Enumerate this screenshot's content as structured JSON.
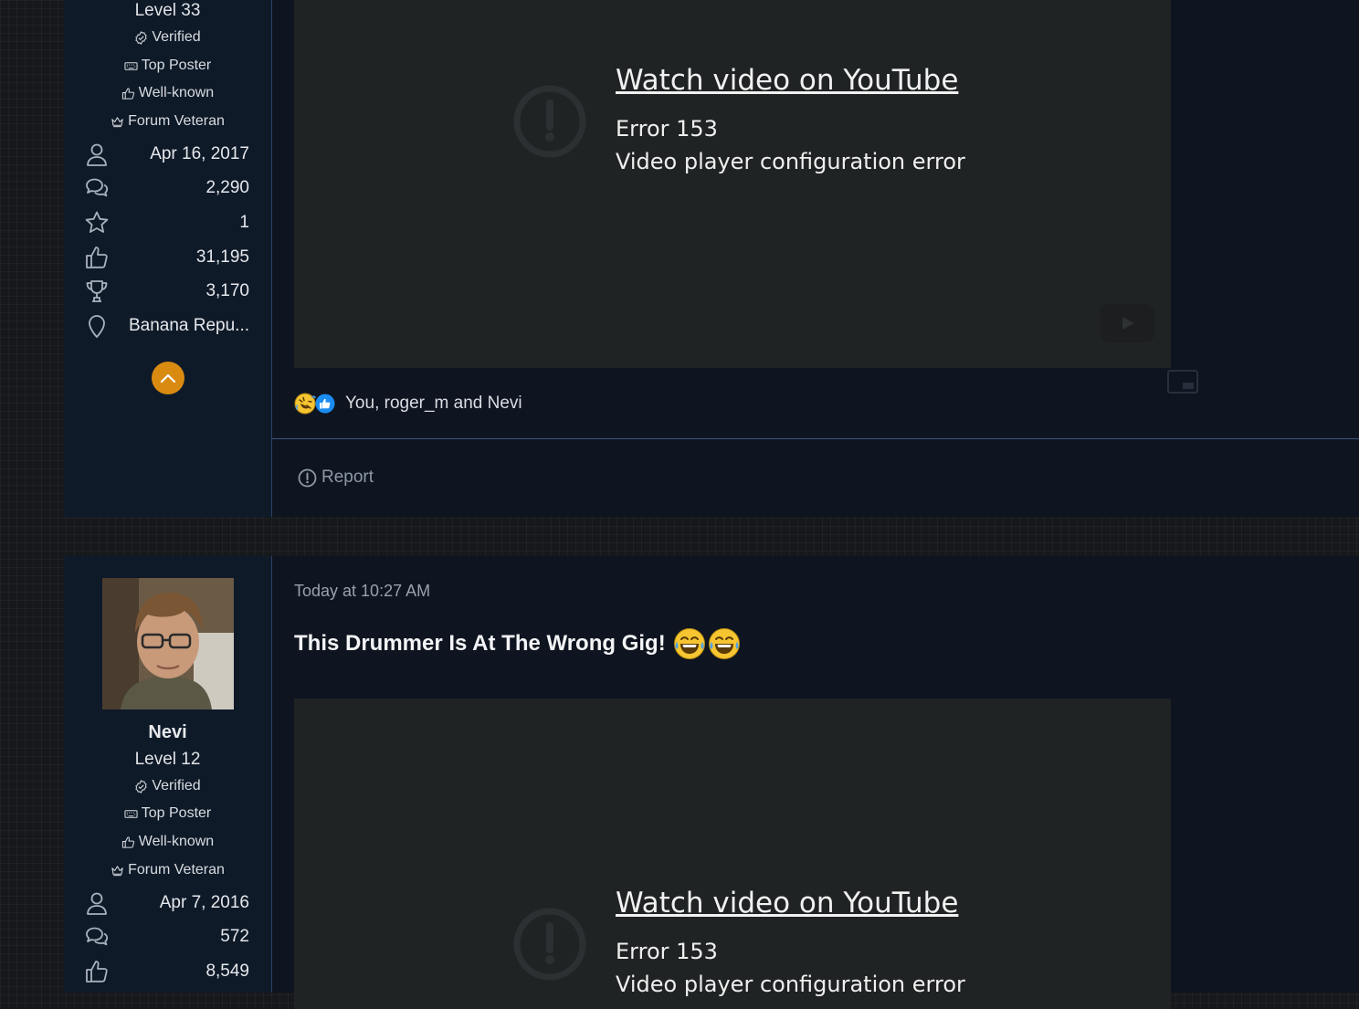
{
  "post1": {
    "user": {
      "level": "Level 33",
      "banners": [
        "Verified",
        "Top Poster",
        "Well-known",
        "Forum Veteran"
      ],
      "stats": [
        {
          "icon": "user-icon",
          "value": "Apr 16, 2017"
        },
        {
          "icon": "messages-icon",
          "value": "2,290"
        },
        {
          "icon": "star-icon",
          "value": "1"
        },
        {
          "icon": "thumbs-up-icon",
          "value": "31,195"
        },
        {
          "icon": "trophy-icon",
          "value": "3,170"
        },
        {
          "icon": "location-pin-icon",
          "value": "Banana Repu..."
        }
      ]
    },
    "video": {
      "link_text": "Watch video on YouTube",
      "error_code": "Error 153",
      "error_message": "Video player configuration error"
    },
    "reactions": {
      "icons": [
        "rofl-reaction-icon",
        "like-reaction-icon"
      ],
      "users_text": "You, roger_m and Nevi"
    },
    "report_label": "Report"
  },
  "post2": {
    "user": {
      "name": "Nevi",
      "level": "Level 12",
      "banners": [
        "Verified",
        "Top Poster",
        "Well-known",
        "Forum Veteran"
      ],
      "stats": [
        {
          "icon": "user-icon",
          "value": "Apr 7, 2016"
        },
        {
          "icon": "messages-icon",
          "value": "572"
        },
        {
          "icon": "thumbs-up-icon",
          "value": "8,549"
        }
      ]
    },
    "timestamp": "Today at 10:27 AM",
    "title": "This Drummer Is At The Wrong Gig!",
    "title_emojis": [
      "tears-of-joy-emoji",
      "tears-of-joy-emoji"
    ],
    "video": {
      "link_text": "Watch video on YouTube",
      "error_code": "Error 153",
      "error_message": "Video player configuration error"
    }
  },
  "colors": {
    "post_background": "#0e1520",
    "user_cell_background": "#0f1a29",
    "divider": "#3c577d",
    "scroll_button": "#d98b11",
    "video_background": "#202324"
  }
}
